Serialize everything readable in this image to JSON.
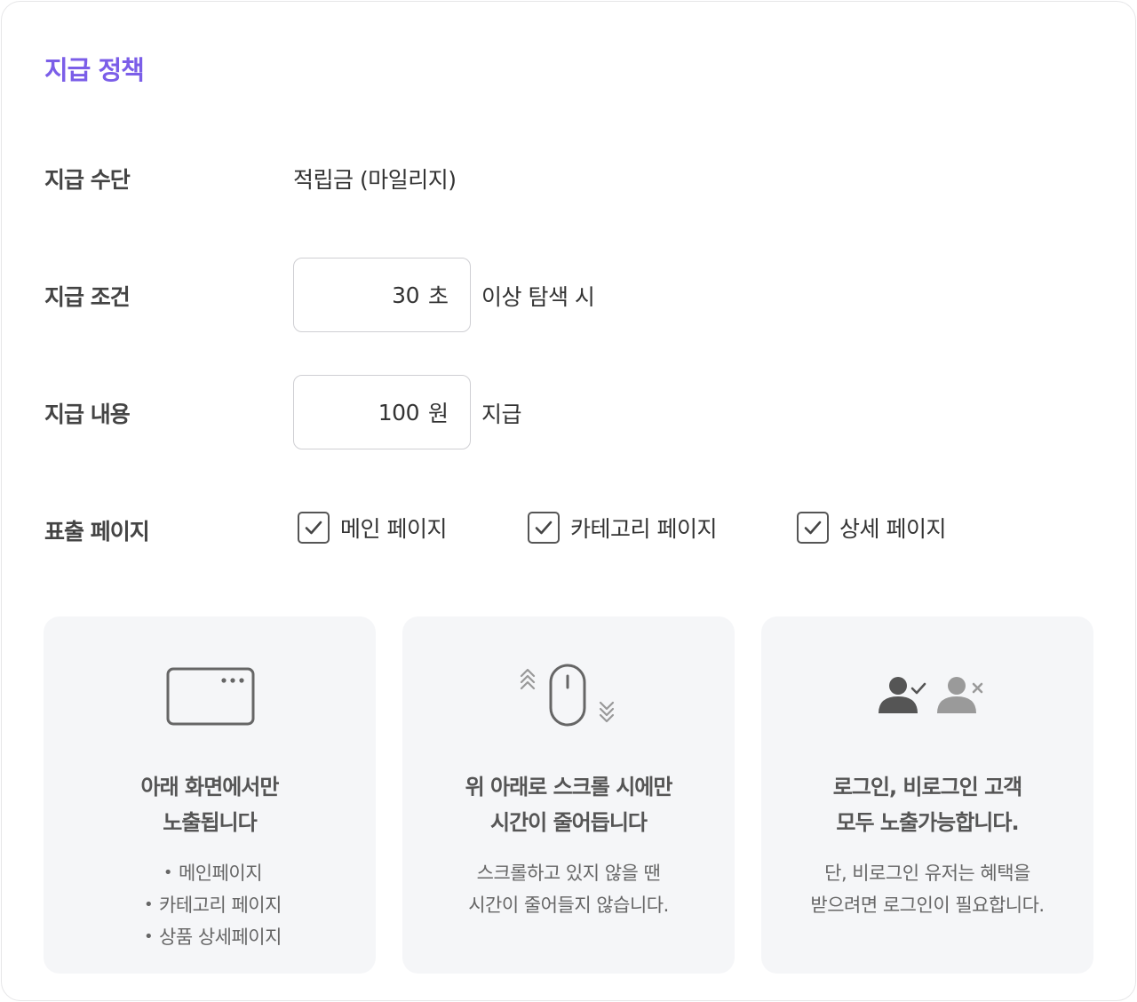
{
  "title": "지급 정책",
  "rows": {
    "method": {
      "label": "지급 수단",
      "value": "적립금 (마일리지)"
    },
    "condition": {
      "label": "지급 조건",
      "input_value": "30",
      "unit": "초",
      "suffix": "이상 탐색 시"
    },
    "content": {
      "label": "지급 내용",
      "input_value": "100",
      "unit": "원",
      "suffix": "지급"
    },
    "pages": {
      "label": "표출 페이지",
      "options": [
        {
          "label": "메인 페이지",
          "checked": true
        },
        {
          "label": "카테고리 페이지",
          "checked": true
        },
        {
          "label": "상세 페이지",
          "checked": true
        }
      ]
    }
  },
  "cards": [
    {
      "icon": "browser-window-icon",
      "heading_line1": "아래 화면에서만",
      "heading_line2": "노출됩니다",
      "list": [
        "메인페이지",
        "카테고리 페이지",
        "상품 상세페이지"
      ]
    },
    {
      "icon": "mouse-scroll-icon",
      "heading_line1": "위 아래로 스크롤 시에만",
      "heading_line2": "시간이 줄어듭니다",
      "body_line1": "스크롤하고 있지 않을 땐",
      "body_line2": "시간이 줄어들지 않습니다."
    },
    {
      "icon": "login-users-icon",
      "heading_line1": "로그인, 비로그인 고객",
      "heading_line2": "모두 노출가능합니다.",
      "body_line1": "단, 비로그인 유저는 혜택을",
      "body_line2": "받으려면 로그인이 필요합니다."
    }
  ],
  "colors": {
    "accent": "#7b5ee8",
    "card_bg": "#f5f6f8",
    "border": "#cfcfd3"
  }
}
